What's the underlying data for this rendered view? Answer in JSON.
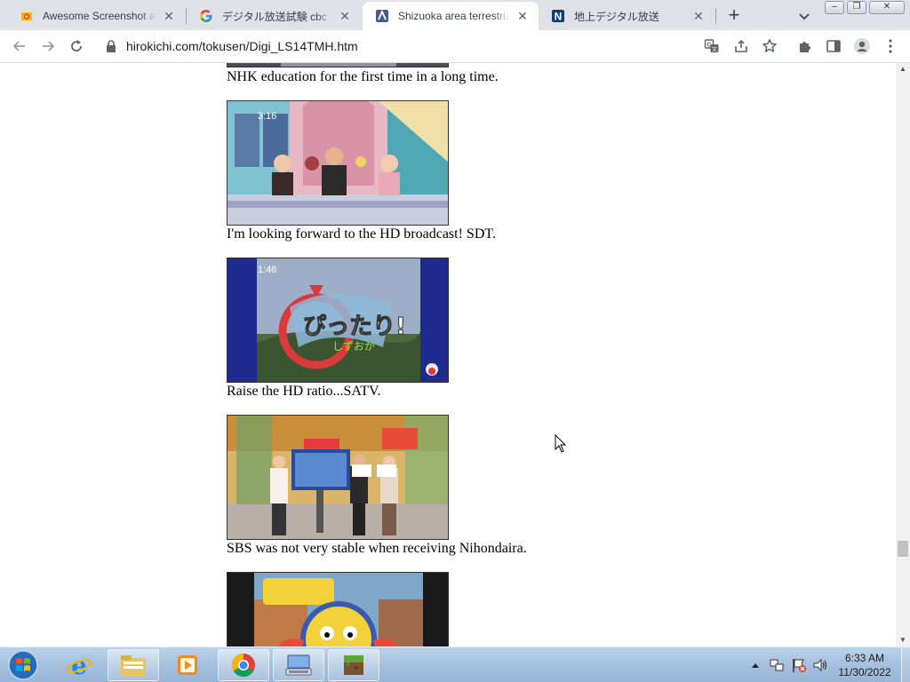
{
  "browser": {
    "tabs": [
      {
        "title": "Awesome Screenshot and",
        "favicon": "awesome-screenshot-icon",
        "active": false
      },
      {
        "title": "デジタル放送試験 cbc - Goo",
        "favicon": "google-icon",
        "active": false
      },
      {
        "title": "Shizuoka area terrestrial d",
        "favicon": "hirokichi-icon",
        "active": true
      },
      {
        "title": "地上デジタル放送",
        "favicon": "nikkei-n-icon",
        "active": false
      }
    ],
    "new_tab_label": "+",
    "url": "hirokichi.com/tokusen/Digi_LS14TMH.htm",
    "accent_color": "#1a73e8"
  },
  "page": {
    "items": [
      {
        "caption": "NHK education for the first time in a long time.",
        "image": "nhk-education-photo"
      },
      {
        "caption": "I'm looking forward to the HD broadcast! SDT.",
        "image": "sdt-studio-photo",
        "overlay": "3:16"
      },
      {
        "caption": "Raise the HD ratio...SATV.",
        "image": "satv-logo-photo",
        "overlay": "1:46"
      },
      {
        "caption": "SBS was not very stable when receiving Nihondaira.",
        "image": "sbs-studio-photo"
      },
      {
        "caption": "",
        "image": "kids-show-photo"
      }
    ]
  },
  "taskbar": {
    "apps": [
      "internet-explorer-icon",
      "file-explorer-icon",
      "media-player-icon",
      "chrome-icon",
      "keyboard-app-icon",
      "minecraft-icon"
    ],
    "time": "6:33 AM",
    "date": "11/30/2022"
  }
}
